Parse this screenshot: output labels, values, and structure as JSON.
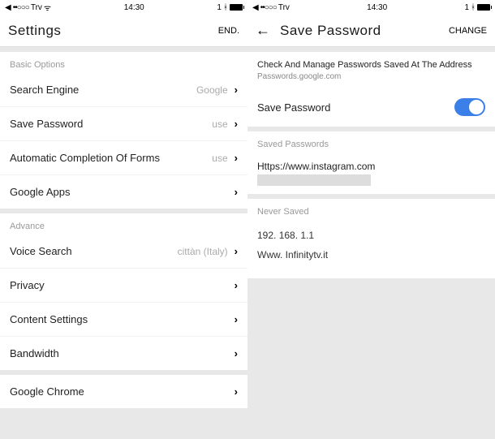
{
  "left": {
    "status": {
      "carrier": "Trv",
      "time": "14:30",
      "bt": "1",
      "signal": "••○○○",
      "wifi": "⚲"
    },
    "header": {
      "title": "Settings",
      "action": "END."
    },
    "basic": {
      "header": "Basic Options",
      "items": [
        {
          "label": "Search Engine",
          "value": "Google"
        },
        {
          "label": "Save Password",
          "value": "use"
        },
        {
          "label": "Automatic Completion Of Forms",
          "value": "use"
        },
        {
          "label": "Google Apps",
          "value": ""
        }
      ]
    },
    "advance": {
      "header": "Advance",
      "items": [
        {
          "label": "Voice Search",
          "value": "cittàn (Italy)"
        },
        {
          "label": "Privacy",
          "value": ""
        },
        {
          "label": "Content Settings",
          "value": ""
        },
        {
          "label": "Bandwidth",
          "value": ""
        }
      ]
    },
    "footer": {
      "label": "Google Chrome"
    }
  },
  "right": {
    "status": {
      "carrier": "Trv",
      "time": "14:30",
      "bt": "1",
      "signal": "••○○○"
    },
    "header": {
      "title": "Save Password",
      "action": "CHANGE"
    },
    "intro": {
      "text": "Check And Manage Passwords Saved At The Address",
      "link": "Passwords.google.com"
    },
    "toggle": {
      "label": "Save Password",
      "on": true
    },
    "saved": {
      "header": "Saved Passwords",
      "item": "Https://www.instagram.com"
    },
    "never": {
      "header": "Never Saved",
      "items": [
        "192. 168. 1.1",
        "Www. Infinitytv.it"
      ]
    }
  }
}
